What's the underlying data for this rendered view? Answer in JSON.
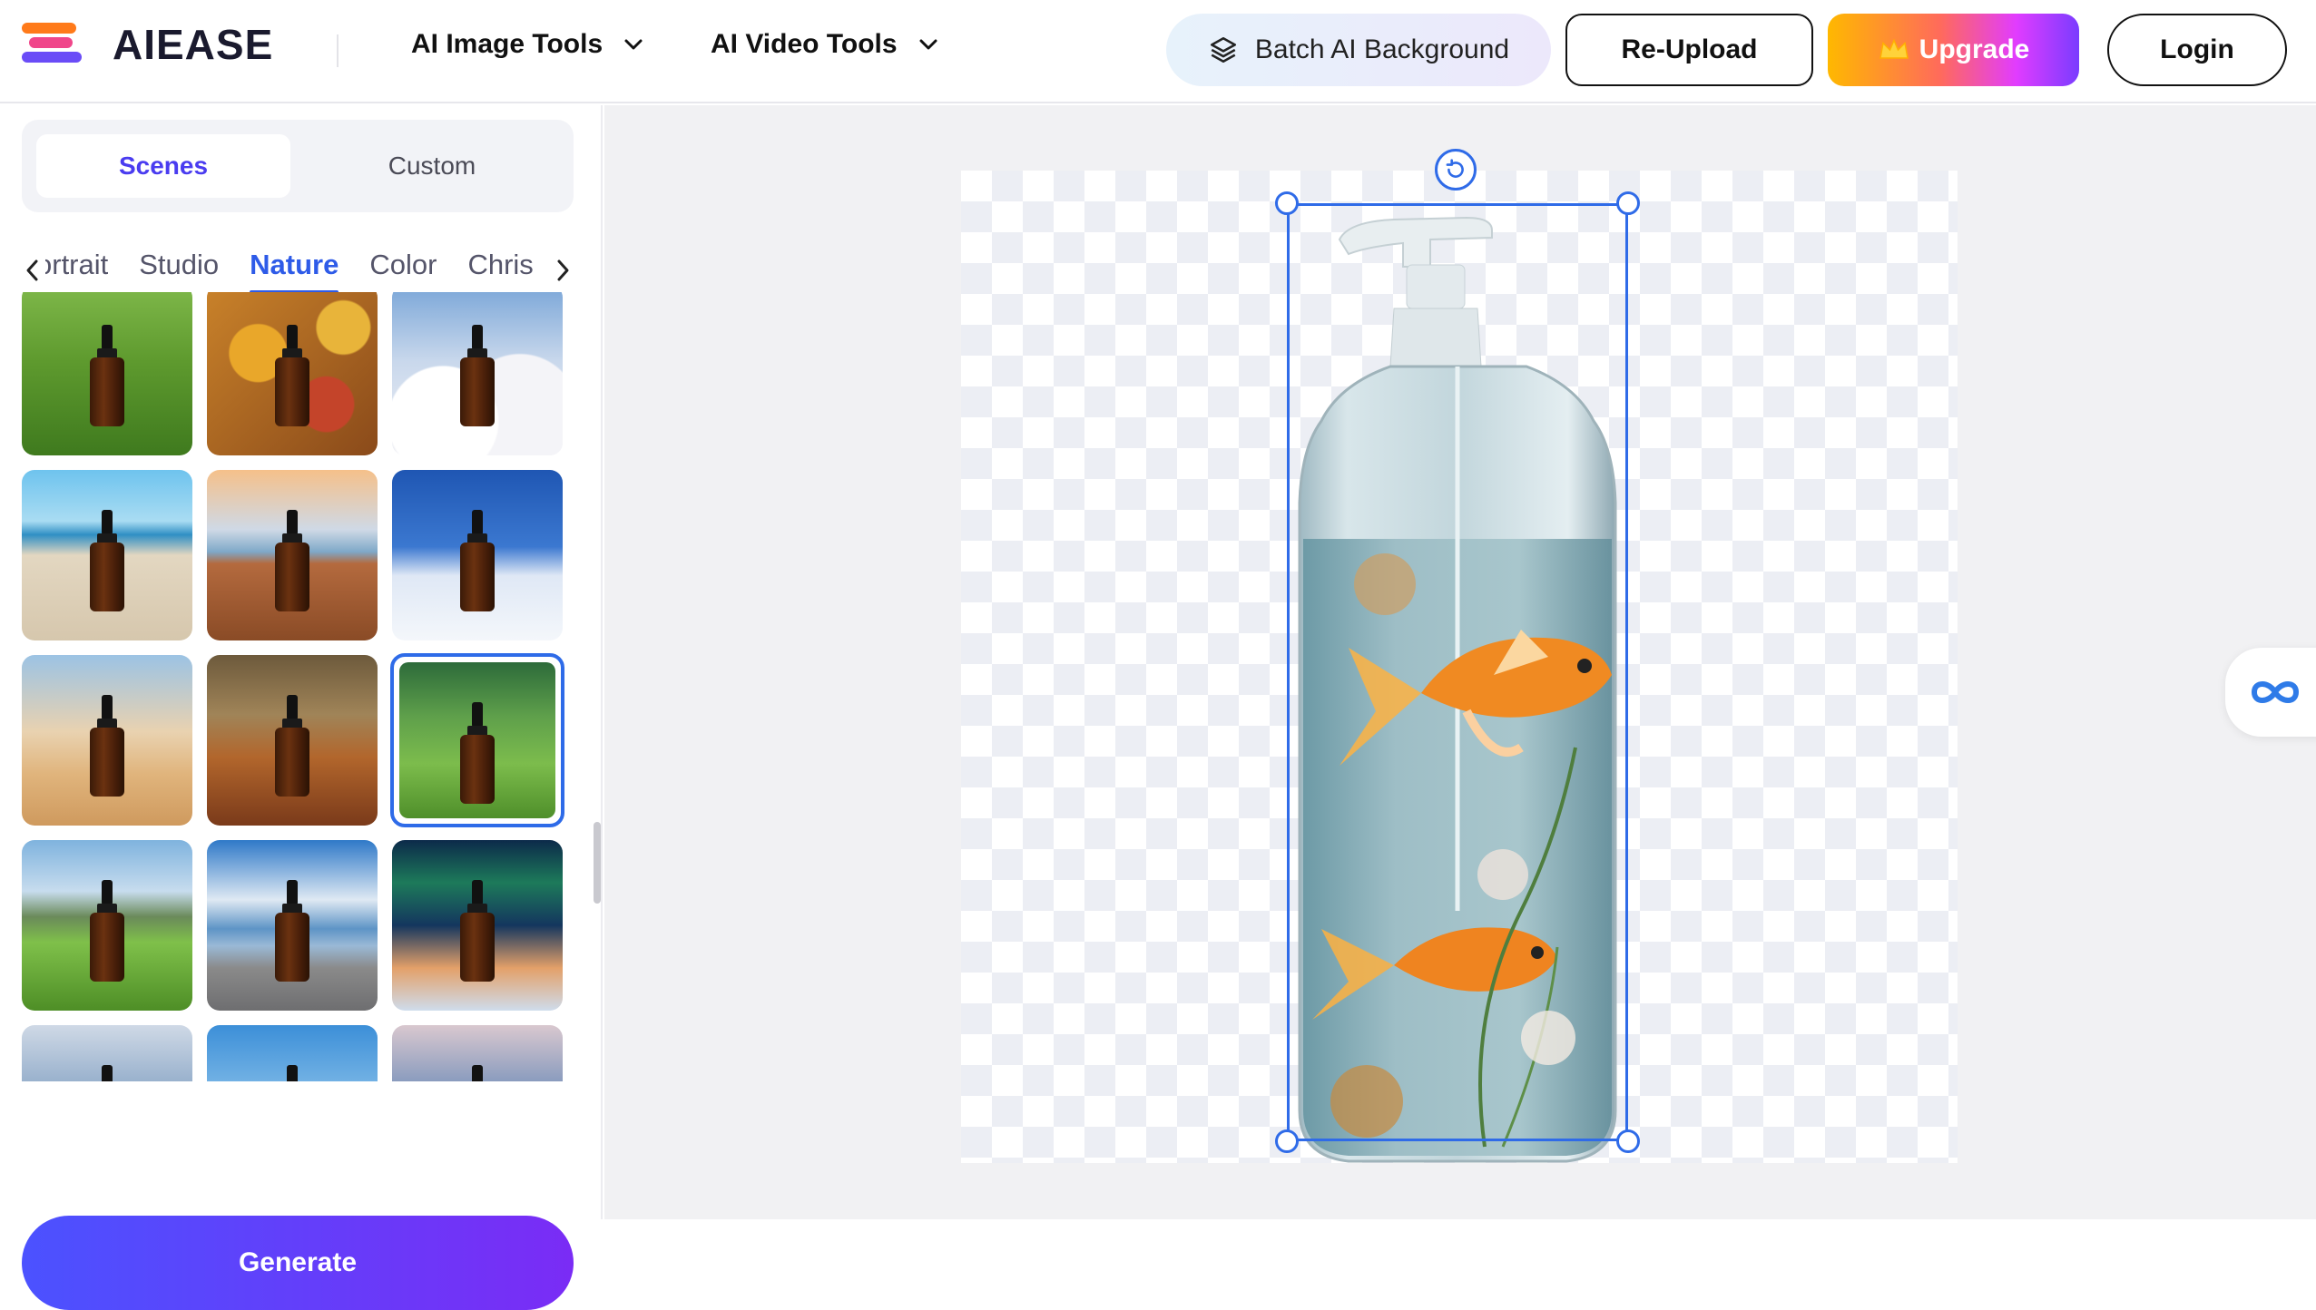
{
  "header": {
    "logo_text": "AIEASE",
    "nav": [
      {
        "label": "AI Image Tools",
        "icon": "chevron-down-icon"
      },
      {
        "label": "AI Video Tools",
        "icon": "chevron-down-icon"
      }
    ],
    "batch_label": "Batch AI Background",
    "reupload_label": "Re-Upload",
    "upgrade_label": "Upgrade",
    "login_label": "Login"
  },
  "panel": {
    "tabs": [
      {
        "label": "Scenes",
        "active": true
      },
      {
        "label": "Custom",
        "active": false
      }
    ],
    "categories": [
      {
        "label": "ortrait",
        "active": false
      },
      {
        "label": "Studio",
        "active": false
      },
      {
        "label": "Nature",
        "active": true
      },
      {
        "label": "Color",
        "active": false
      },
      {
        "label": "Chris",
        "active": false
      }
    ],
    "scenes": [
      {
        "name": "grass",
        "bg": "linear-gradient(180deg,#7fb84a 0%,#5e9a2e 45%,#3f7a1e 100%)"
      },
      {
        "name": "autumn-leaves",
        "bg": "radial-gradient(circle at 30% 40%,#e9a72a 0 18%,transparent 19%),radial-gradient(circle at 70% 70%,#c4442a 0 16%,transparent 17%),radial-gradient(circle at 80% 25%,#e8b43a 0 14%,transparent 15%),linear-gradient(135deg,#c9822a,#8a4a1a)"
      },
      {
        "name": "clouds",
        "bg": "radial-gradient(circle at 30% 80%,#fff 0 30%,transparent 31%),radial-gradient(circle at 75% 75%,#f4f4f8 0 32%,transparent 33%),linear-gradient(180deg,#7aa6d8 0%,#c9d8ec 45%,#f1f1f5 100%)"
      },
      {
        "name": "beach",
        "bg": "linear-gradient(180deg,#6ec3ee 0%,#a9dcf2 30%,#2f8fc4 38%,#e3d7c1 50%,#d6c7ad 100%)"
      },
      {
        "name": "wood-deck-sea",
        "bg": "linear-gradient(180deg,#f5c08a 0%,#cfd9e6 35%,#7fa8c8 48%,#b46a3e 55%,#8a4b26 100%)"
      },
      {
        "name": "snowman",
        "bg": "linear-gradient(180deg,#1f56b3 0%,#3b78d0 45%,#dfe8f5 62%,#f4f7fb 100%)"
      },
      {
        "name": "desert",
        "bg": "linear-gradient(180deg,#9cc3e4 0%,#e9d2b0 45%,#e0b47c 70%,#cf9a5e 100%)"
      },
      {
        "name": "forest-floor",
        "bg": "linear-gradient(180deg,#6d5a3c 0%,#a08458 35%,#b2662c 60%,#7a3a1a 100%)"
      },
      {
        "name": "jungle-grass",
        "bg": "linear-gradient(180deg,#2d6b3a 0%,#5fa04b 35%,#7cbc4c 65%,#4f8f2a 100%)",
        "selected": true
      },
      {
        "name": "mountain-meadow",
        "bg": "linear-gradient(180deg,#7fb3de 0%,#c7dcee 30%,#6a8a5a 45%,#7fc04a 60%,#4e8e26 100%)"
      },
      {
        "name": "lake-mountain",
        "bg": "linear-gradient(180deg,#2f79c8 0%,#dfe9f3 35%,#5e94c6 52%,#9ab9d6 62%,#8a8a8a 75%,#6e6e70 100%)"
      },
      {
        "name": "aurora",
        "bg": "linear-gradient(180deg,#0c2a4a 0%,#1d7a5a 25%,#14365e 50%,#e3a069 75%,#cfdcec 100%)"
      },
      {
        "name": "winter-trees",
        "bg": "linear-gradient(180deg,#cfd9e6 0%,#8ea9c8 40%,#eef2f7 100%)"
      },
      {
        "name": "palm-sky",
        "bg": "linear-gradient(180deg,#3c8fd8 0%,#8cc2ea 50%,#e9efe0 100%)"
      },
      {
        "name": "sunset-peaks",
        "bg": "linear-gradient(180deg,#d9c8cf 0%,#6e8cb8 45%,#e0a88f 100%)"
      }
    ],
    "generate_label": "Generate"
  },
  "canvas": {
    "colors": {
      "selection": "#2f6be8",
      "checker": "#eceef4"
    }
  }
}
